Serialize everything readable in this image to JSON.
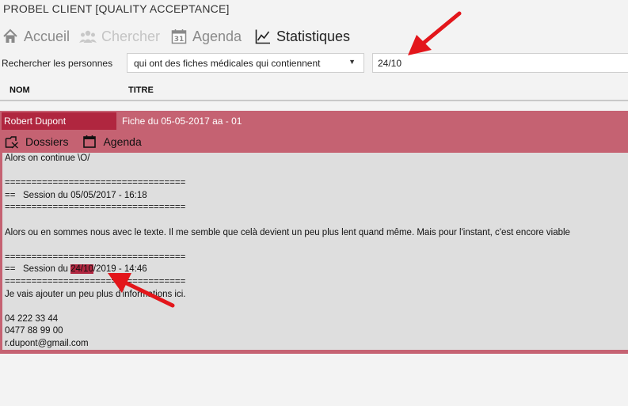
{
  "app": {
    "title": "PROBEL CLIENT [QUALITY ACCEPTANCE]"
  },
  "nav": {
    "accueil": "Accueil",
    "chercher": "Chercher",
    "agenda": "Agenda",
    "statistiques": "Statistiques"
  },
  "search": {
    "label": "Rechercher les personnes",
    "criteria": "qui ont des fiches médicales qui contiennent",
    "query": "24/10"
  },
  "table": {
    "columns": [
      "NOM",
      "TITRE"
    ]
  },
  "record": {
    "name": "Robert Dupont",
    "title": "Fiche du 05-05-2017 aa - 01",
    "actions": {
      "dossiers": "Dossiers",
      "agenda": "Agenda"
    }
  },
  "note": {
    "line1": "Alors on continue \\O/",
    "separator": "==================================",
    "session1": "==   Session du 05/05/2017 - 16:18",
    "paragraph": "Alors ou en sommes nous avec le texte. Il me semble que celà devient un peu plus lent quand même. Mais pour l'instant, c'est encore viable",
    "session2_prefix": "==   Session du ",
    "session2_match": "24/10",
    "session2_suffix": "/2019 - 14:46",
    "info": "Je vais ajouter un peu plus d'informations ici.",
    "phone1": "04 222 33 44",
    "phone2": "0477 88 99 00",
    "email": "r.dupont@gmail.com"
  },
  "colors": {
    "record_bg": "#c56272",
    "record_name_bg": "#b0263f",
    "note_bg": "#dedede",
    "highlight": "#b0263f",
    "annotation_arrow": "#e3161b"
  },
  "icons": {
    "accueil": "home-icon",
    "chercher": "people-icon",
    "agenda": "calendar-31-icon",
    "statistiques": "line-chart-icon",
    "dossiers": "folder-icon",
    "record_agenda": "calendar-icon",
    "criteria": "chevron-down-icon"
  }
}
